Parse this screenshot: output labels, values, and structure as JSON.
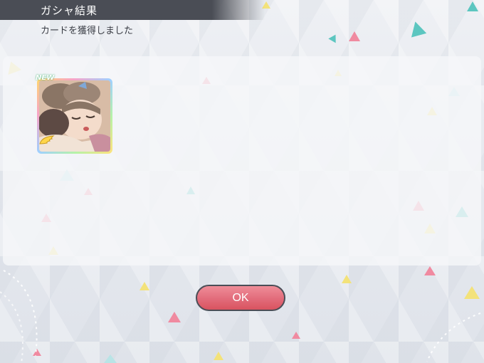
{
  "header": {
    "title": "ガシャ結果",
    "subtitle": "カードを獲得しました"
  },
  "card": {
    "badge": "NEW",
    "icon": "wing-icon",
    "rarity_frame": "rainbow"
  },
  "ok_button": {
    "label": "OK"
  },
  "colors": {
    "header_bg": "#4a4d55",
    "button_top": "#ef8d98",
    "button_bottom": "#d9535f",
    "accent_teal": "#5cc6c0",
    "accent_pink": "#f08aa0",
    "accent_yellow": "#f3e27a"
  }
}
